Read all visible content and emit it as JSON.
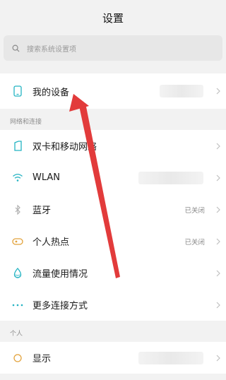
{
  "header": {
    "title": "设置"
  },
  "search": {
    "placeholder": "搜索系统设置项"
  },
  "device": {
    "label": "我的设备"
  },
  "network": {
    "section_title": "网络和连接",
    "items": [
      {
        "label": "双卡和移动网络",
        "value": "",
        "icon": "sim-card-icon"
      },
      {
        "label": "WLAN",
        "value": "",
        "icon": "wifi-icon"
      },
      {
        "label": "蓝牙",
        "value": "已关闭",
        "icon": "bluetooth-icon"
      },
      {
        "label": "个人热点",
        "value": "已关闭",
        "icon": "hotspot-icon"
      },
      {
        "label": "流量使用情况",
        "value": "",
        "icon": "data-usage-icon"
      },
      {
        "label": "更多连接方式",
        "value": "",
        "icon": "more-connections-icon"
      }
    ]
  },
  "personal": {
    "section_title": "个人",
    "items": [
      {
        "label": "显示",
        "value": "",
        "icon": "display-icon"
      }
    ]
  },
  "colors": {
    "accent": "#23b3c2",
    "arrow": "#e23b3b"
  }
}
